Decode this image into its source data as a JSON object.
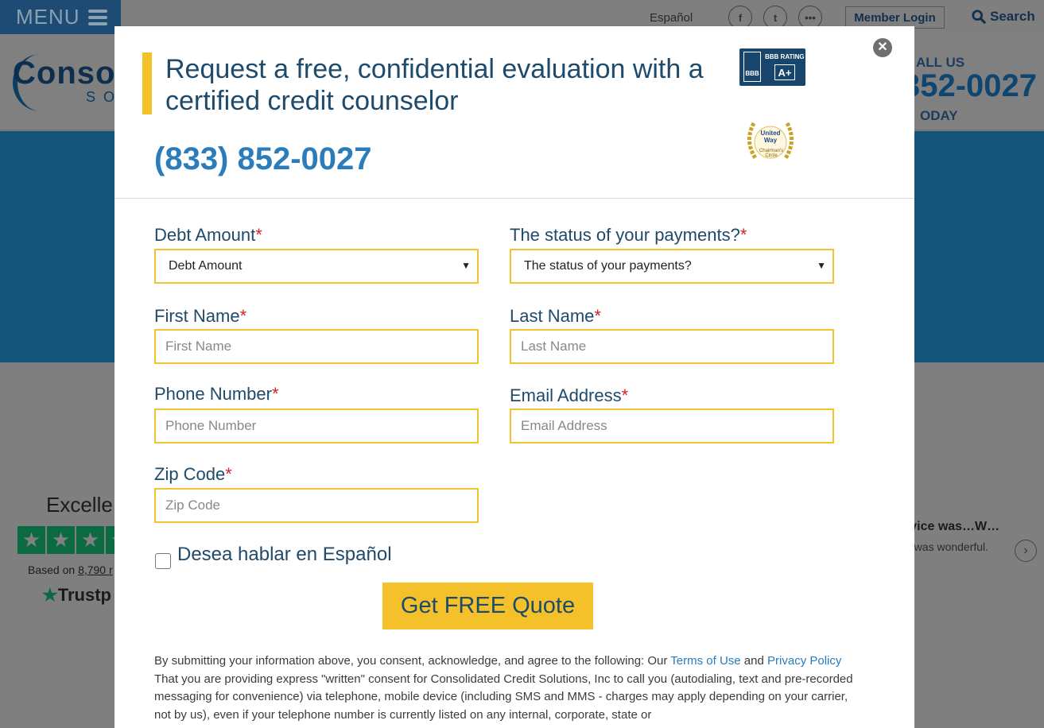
{
  "nav": {
    "menu_label": "MENU",
    "language_link": "Español",
    "member_login": "Member Login",
    "search_label": "Search"
  },
  "header": {
    "logo_text": "Conso",
    "logo_sub": "SO",
    "call_us": "ALL US",
    "call_number": "352-0027",
    "call_today": "ODAY"
  },
  "trustpilot": {
    "title": "Excelle",
    "based_on_prefix": "Based on",
    "review_count": "8,790 r",
    "logo": "Trustp",
    "review_title": "rvice was…W…",
    "review_body": "e was wonderful."
  },
  "modal": {
    "headline": "Request a free, confidential evaluation with a certified credit counselor",
    "phone": "(833) 852-0027",
    "bbb_rating_label": "BBB RATING",
    "bbb_grade": "A+",
    "bbb_short": "BBB",
    "united_way": "United Way",
    "united_way_sub": "Chairman's Circle",
    "form": {
      "debt_amount": {
        "label": "Debt Amount",
        "value": "Debt Amount"
      },
      "payment_status": {
        "label": "The status of your payments?",
        "value": "The status of your payments?"
      },
      "first_name": {
        "label": "First Name",
        "placeholder": "First Name"
      },
      "last_name": {
        "label": "Last Name",
        "placeholder": "Last Name"
      },
      "phone": {
        "label": "Phone Number",
        "placeholder": "Phone Number"
      },
      "email": {
        "label": "Email Address",
        "placeholder": "Email Address"
      },
      "zip": {
        "label": "Zip Code",
        "placeholder": "Zip Code"
      },
      "required_mark": "*",
      "spanish_checkbox": "Desea hablar en Español",
      "submit": "Get FREE Quote"
    },
    "legal": {
      "intro": "By submitting your information above, you consent, acknowledge, and agree to the following: Our ",
      "terms_link": "Terms of Use",
      "and": " and ",
      "privacy_link": "Privacy Policy",
      "body": " That you are providing express \"written\" consent for Consolidated Credit Solutions, Inc to call you (autodialing, text and pre-recorded messaging for convenience) via telephone, mobile device (including SMS and MMS - charges may apply depending on your carrier, not by us), even if your telephone number is currently listed on any internal, corporate, state or"
    }
  }
}
